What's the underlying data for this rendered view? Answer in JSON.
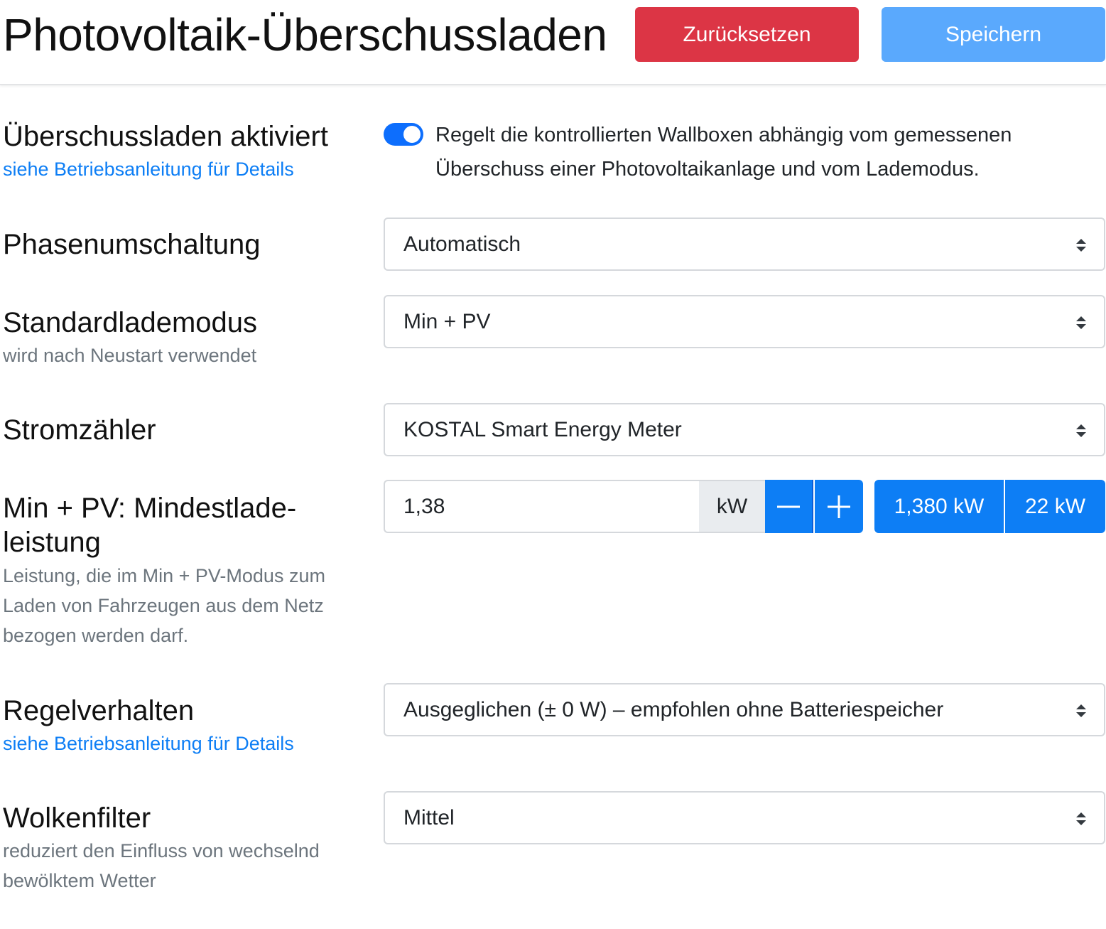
{
  "header": {
    "title": "Photovoltaik-Überschussladen",
    "reset_label": "Zurücksetzen",
    "save_label": "Speichern"
  },
  "colors": {
    "danger": "#dc3545",
    "primary": "#0d7ef5",
    "primary_light": "#5aa9fd"
  },
  "surplus": {
    "label": "Überschussladen aktiviert",
    "link": "siehe Betriebsanleitung für Details",
    "enabled": true,
    "description": "Regelt die kontrollierten Wallboxen abhängig vom gemessenen Überschuss einer Photovoltaikanlage und vom Lademodus."
  },
  "phase_switching": {
    "label": "Phasenumschaltung",
    "value": "Automatisch"
  },
  "default_mode": {
    "label": "Standardlademodus",
    "sub": "wird nach Neustart verwendet",
    "value": "Min + PV"
  },
  "meter": {
    "label": "Stromzähler",
    "value": "KOSTAL Smart Energy Meter"
  },
  "min_power": {
    "label_line1": "Min + PV: Mindestlade-",
    "label_line2": "leistung",
    "sub_line1": "Leistung, die im Min + PV-Modus zum",
    "sub_line2": "Laden von Fahrzeugen aus dem Netz",
    "sub_line3": "bezogen werden darf.",
    "value": "1,38",
    "unit": "kW",
    "preset_1": "1,380 kW",
    "preset_2": "22 kW"
  },
  "control": {
    "label": "Regelverhalten",
    "link": "siehe Betriebsanleitung für Details",
    "value": "Ausgeglichen (± 0 W) – empfohlen ohne Batteriespeicher"
  },
  "cloud_filter": {
    "label": "Wolkenfilter",
    "sub_line1": "reduziert den Einfluss von wechselnd",
    "sub_line2": "bewölktem Wetter",
    "value": "Mittel"
  }
}
